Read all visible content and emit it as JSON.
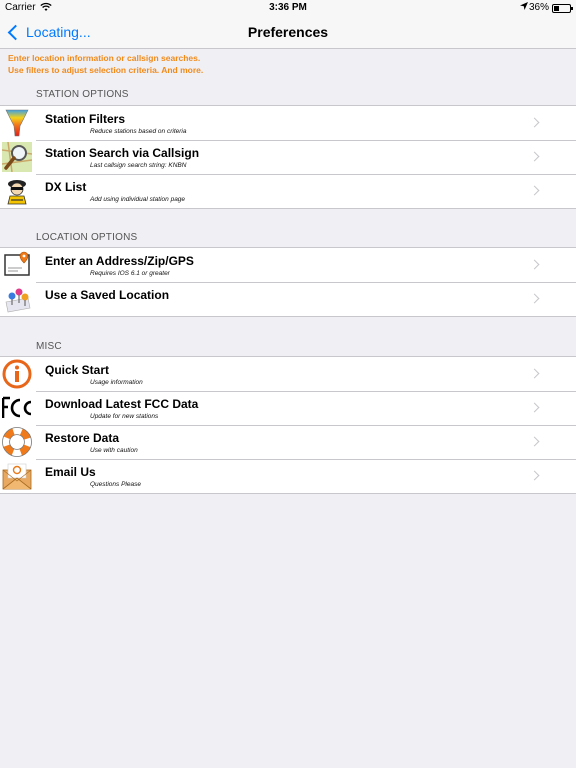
{
  "status_bar": {
    "carrier": "Carrier",
    "time": "3:36 PM",
    "battery": "36%",
    "battery_level": 0.36
  },
  "nav": {
    "back_label": "Locating...",
    "title": "Preferences"
  },
  "intro": {
    "line1": "Enter location information or callsign searches.",
    "line2": "Use filters to adjust selection criteria. And more."
  },
  "sections": [
    {
      "header": "STATION OPTIONS",
      "rows": [
        {
          "icon": "funnel-icon",
          "title": "Station Filters",
          "subtitle": "Reduce stations based on criteria"
        },
        {
          "icon": "magnifier-map-icon",
          "title": "Station Search via Callsign",
          "subtitle": "Last callsign search string: KNBN"
        },
        {
          "icon": "dx-character-icon",
          "title": "DX List",
          "subtitle": "Add using individual station page"
        }
      ]
    },
    {
      "header": "LOCATION OPTIONS",
      "rows": [
        {
          "icon": "map-pin-card-icon",
          "title": "Enter an Address/Zip/GPS",
          "subtitle": "Requires IOS 6.1 or greater"
        },
        {
          "icon": "saved-pins-icon",
          "title": "Use a Saved Location",
          "subtitle": ""
        }
      ]
    },
    {
      "header": "MISC",
      "rows": [
        {
          "icon": "info-icon",
          "title": "Quick Start",
          "subtitle": "Usage information"
        },
        {
          "icon": "fcc-logo-icon",
          "title": "Download Latest FCC Data",
          "subtitle": "Update for new stations"
        },
        {
          "icon": "life-ring-icon",
          "title": "Restore Data",
          "subtitle": "Use with caution"
        },
        {
          "icon": "email-envelope-icon",
          "title": "Email Us",
          "subtitle": "Questions Please"
        }
      ]
    }
  ]
}
